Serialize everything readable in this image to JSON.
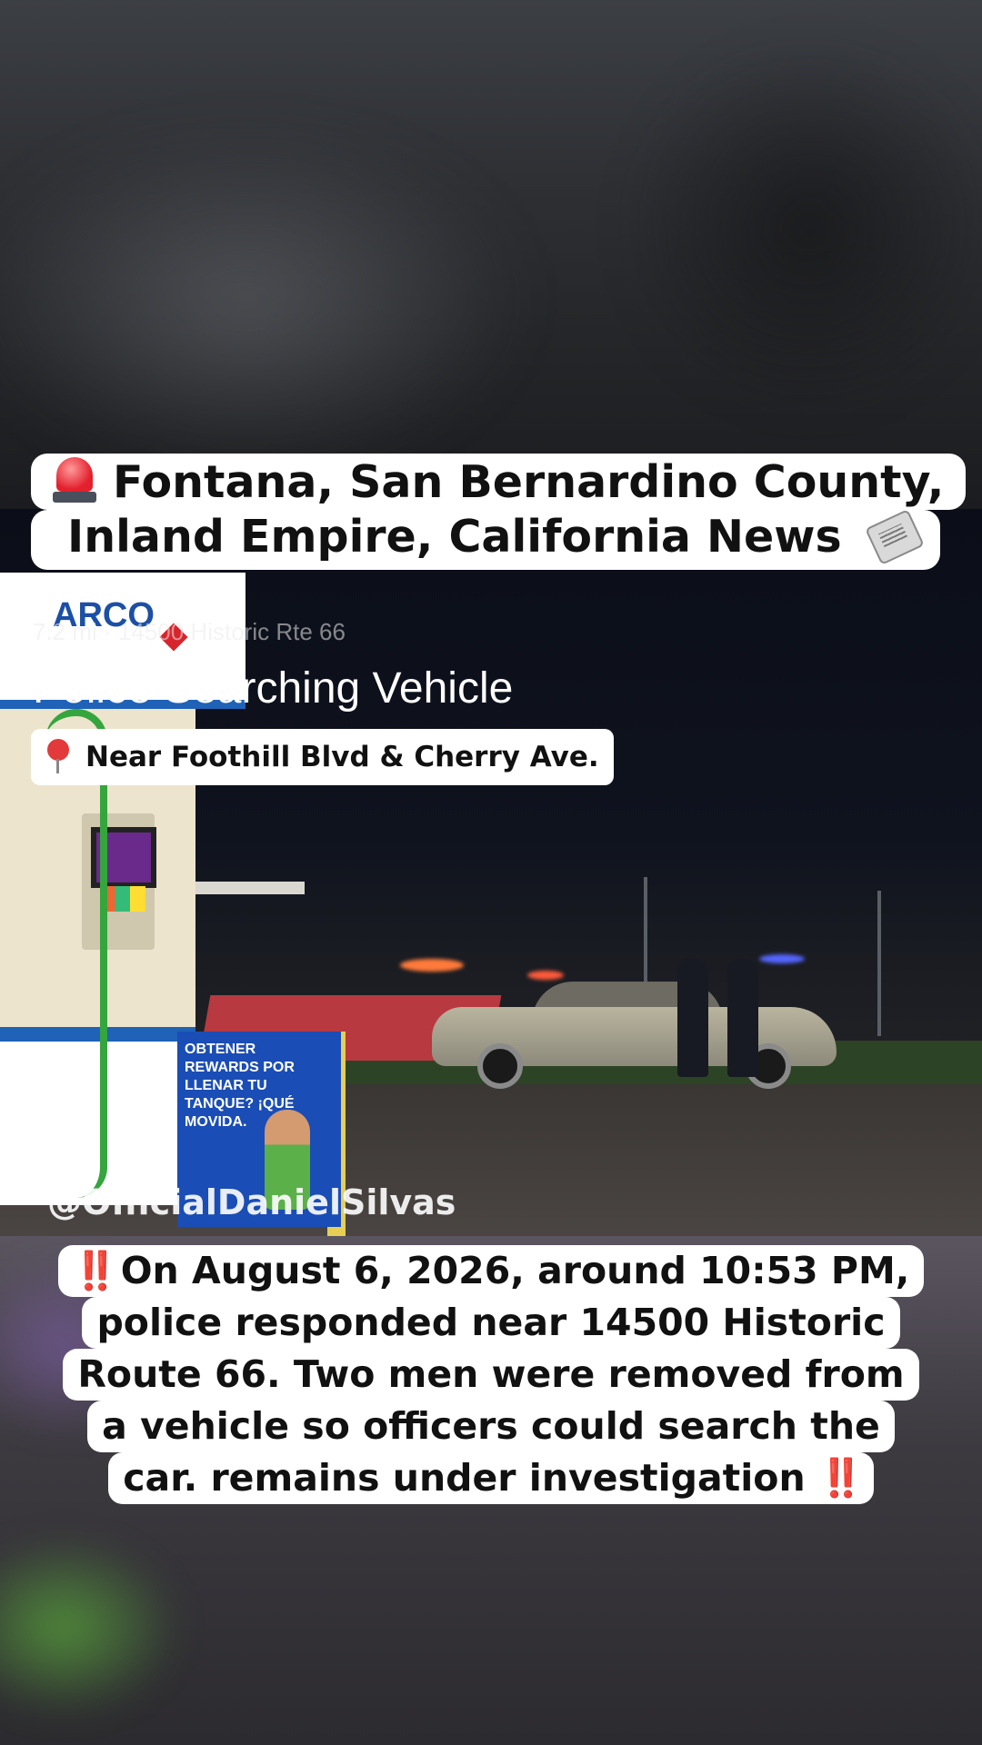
{
  "header": {
    "title_line1": "Fontana, San Bernardino County,",
    "title_line2": "Inland Empire, California News",
    "siren_icon": "siren-icon",
    "newspaper_icon": "newspaper-icon"
  },
  "meta": {
    "distance_address": "7.2 mi · 14500 Historic Rte 66"
  },
  "headline": "Police Searching Vehicle",
  "location": {
    "icon": "pin-icon",
    "text": "Near Foothill Blvd & Cherry Ave."
  },
  "video": {
    "watermark": "@OfficialDanielSilvas",
    "pump_brand": "ARCO",
    "sign_text": "OBTENER REWARDS POR LLENAR TU TANQUE? ¡QUÉ MOVIDA."
  },
  "caption": {
    "alert_icon": "double-exclamation",
    "bang": "‼️",
    "lines": [
      "On August 6, 2026, around 10:53 PM,",
      "police responded near 14500 Historic",
      "Route 66. Two men were removed from",
      "a vehicle so officers could search the",
      "car. remains under investigation"
    ]
  },
  "colors": {
    "alert_red": "#e81c2a",
    "arco_blue": "#1f62b7",
    "overlay_white": "#ffffff"
  }
}
